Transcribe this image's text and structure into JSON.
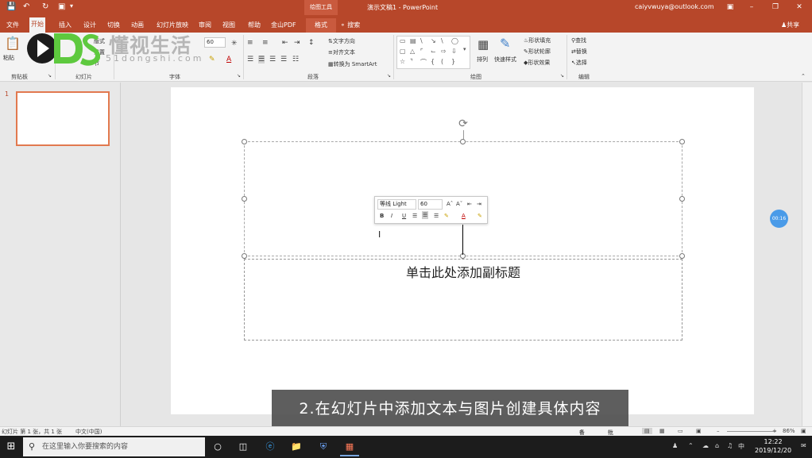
{
  "titlebar": {
    "context_tab_header": "绘图工具",
    "doc_title": "演示文稿1 - PowerPoint",
    "account": "caiyvwuya@outlook.com",
    "ribbon_display_icon": "ribbon-display-icon",
    "min_icon": "minimize-icon",
    "restore_icon": "restore-icon",
    "close_icon": "close-icon"
  },
  "tabs": [
    "文件",
    "开始",
    "插入",
    "设计",
    "切换",
    "动画",
    "幻灯片放映",
    "审阅",
    "视图",
    "帮助",
    "金山PDF",
    "格式"
  ],
  "active_tab": "开始",
  "tell_me": "搜索",
  "share": "共享",
  "ribbon": {
    "paste": "粘贴",
    "new_slide": "新建\n幻灯片",
    "layout": "版式",
    "reset": "重置",
    "section": "节",
    "font_size_placeholder": "60",
    "text_direction": "文字方向",
    "align_text": "对齐文本",
    "convert_smartart": "转换为 SmartArt",
    "arrange": "排列",
    "quick_styles": "快速样式",
    "shape_fill": "形状填充",
    "shape_outline": "形状轮廓",
    "shape_effects": "形状效果",
    "find": "查找",
    "replace": "替换",
    "select": "选择",
    "groups": {
      "clipboard": "剪贴板",
      "slides": "幻灯片",
      "font": "字体",
      "paragraph": "段落",
      "drawing": "绘图",
      "editing": "编辑"
    }
  },
  "watermark": {
    "title": "懂视生活",
    "pinyin": "51dongshi.com"
  },
  "thumbnail": {
    "number": "1"
  },
  "slide": {
    "subtitle_placeholder": "单击此处添加副标题"
  },
  "mini_toolbar": {
    "font": "等线 Light",
    "size": "60",
    "bold": "B",
    "italic": "I",
    "underline": "U"
  },
  "timer": "00:16",
  "caption": "2.在幻灯片中添加文本与图片创建具体内容",
  "status": {
    "slide_info": "幻灯片 第 1 张，共 1 张",
    "language": "中文(中国)",
    "notes": "备注",
    "comments": "批注",
    "zoom": "86%"
  },
  "taskbar": {
    "search_placeholder": "在这里输入你要搜索的内容",
    "ime": "中",
    "time": "12:22",
    "date": "2019/12/20"
  },
  "colors": {
    "accent": "#b7472a",
    "thumb_border": "#e2794f",
    "timer": "#4a9be8"
  }
}
